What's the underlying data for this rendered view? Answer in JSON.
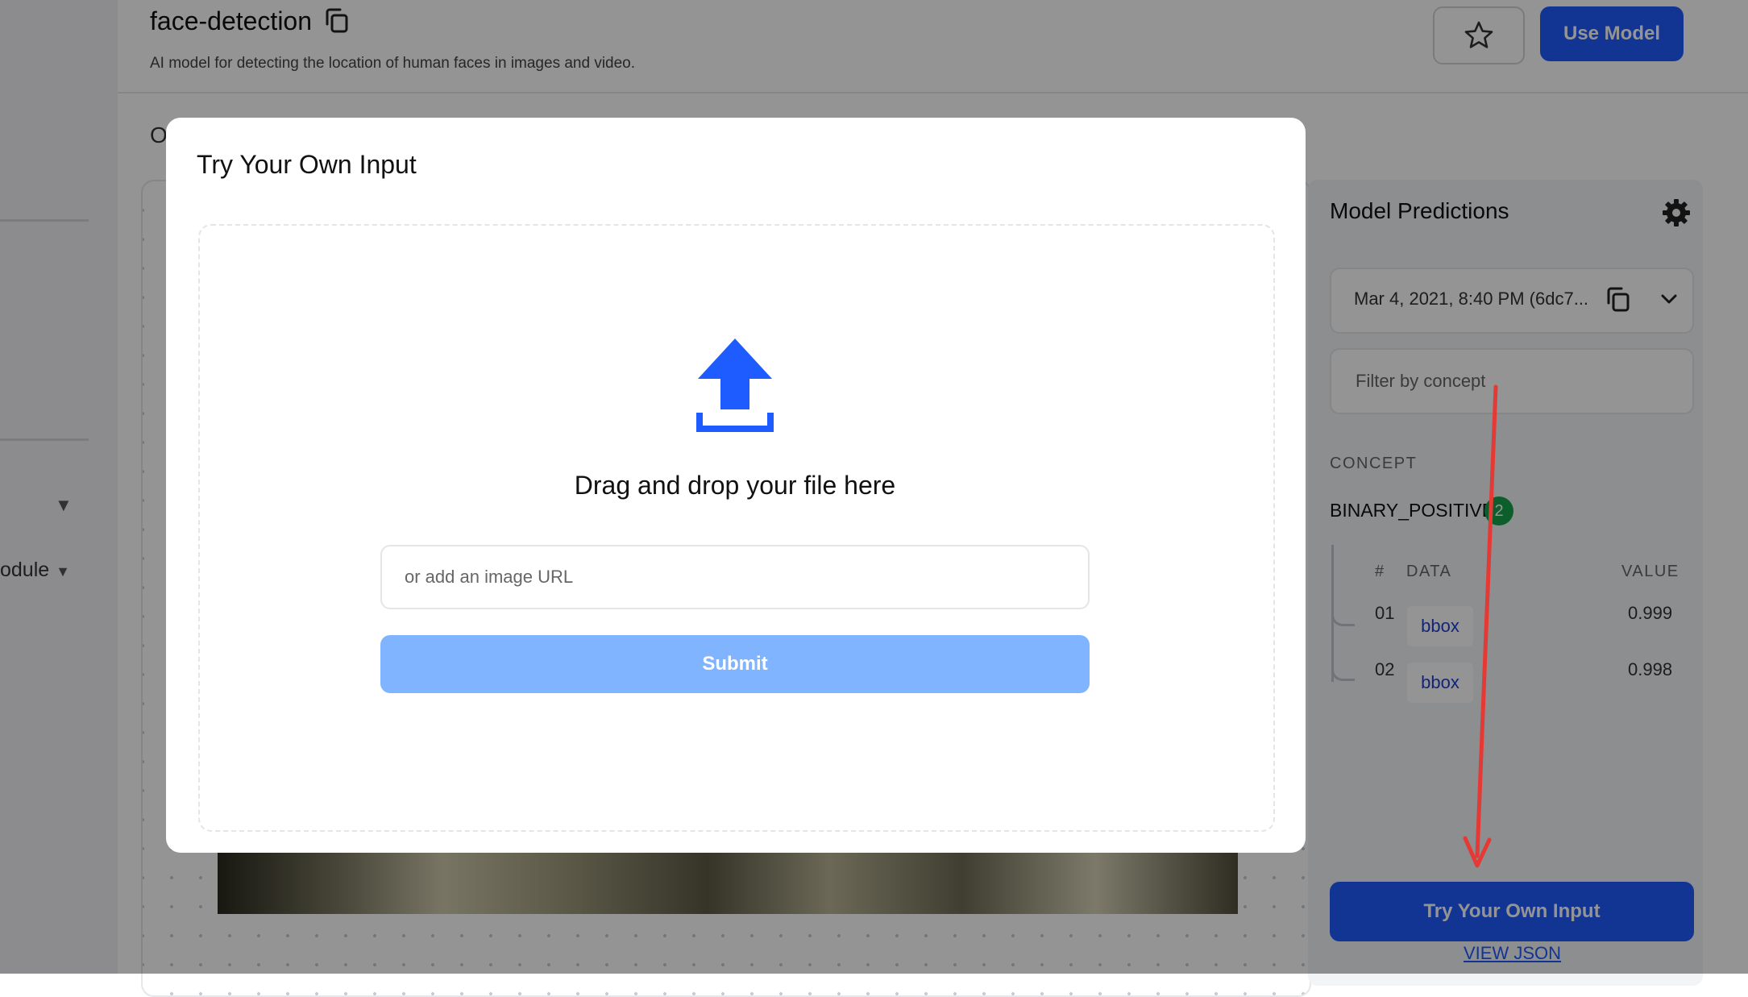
{
  "sidebar": {
    "module_label": "odule",
    "caret_glyph": "▼"
  },
  "header": {
    "model_title": "face-detection",
    "model_description": "AI model for detecting the location of human faces in images and video.",
    "use_model_label": "Use Model"
  },
  "main": {
    "partial_letter": "O"
  },
  "predictions": {
    "title": "Model Predictions",
    "version_selected": "Mar 4, 2021, 8:40 PM (6dc7...",
    "filter_placeholder": "Filter by concept",
    "concept_heading": "CONCEPT",
    "concept_name": "BINARY_POSITIVE",
    "concept_count": "2",
    "columns": {
      "num": "#",
      "data": "DATA",
      "value": "VALUE"
    },
    "rows": [
      {
        "num": "01",
        "data": "bbox",
        "value": "0.999"
      },
      {
        "num": "02",
        "data": "bbox",
        "value": "0.998"
      }
    ],
    "try_button_label": "Try Your Own Input",
    "view_json_label": "VIEW JSON"
  },
  "modal": {
    "title": "Try Your Own Input",
    "drop_text": "Drag and drop your file here",
    "url_placeholder": "or add an image URL",
    "submit_label": "Submit"
  },
  "colors": {
    "primary_blue": "#1f5cff",
    "submit_disabled_blue": "#80b4ff",
    "upload_icon_blue": "#1f5cff",
    "concept_badge_green": "#16a34a",
    "annotation_red": "#e53935"
  },
  "icons": {
    "title_copy": "copy-icon",
    "star": "star-icon",
    "settings": "gear-icon",
    "version_copy": "copy-icon",
    "version_dropdown": "chevron-down-icon",
    "upload": "upload-icon"
  }
}
